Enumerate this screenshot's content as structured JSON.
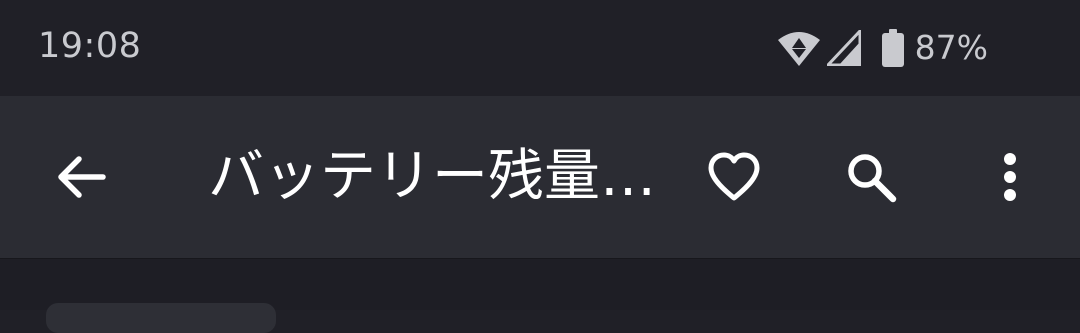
{
  "status_bar": {
    "time": "19:08",
    "battery_percent": "87%",
    "icons": [
      "wifi-icon",
      "cell-signal-icon",
      "battery-icon"
    ]
  },
  "app_bar": {
    "title": "バッテリー残量…",
    "actions": [
      "back-arrow-icon",
      "heart-icon",
      "search-icon",
      "more-vert-icon"
    ]
  },
  "colors": {
    "status_bar_bg": "#202027",
    "app_bar_bg": "#2b2c33",
    "text_primary": "#ffffff",
    "text_status": "#c9cacf"
  }
}
